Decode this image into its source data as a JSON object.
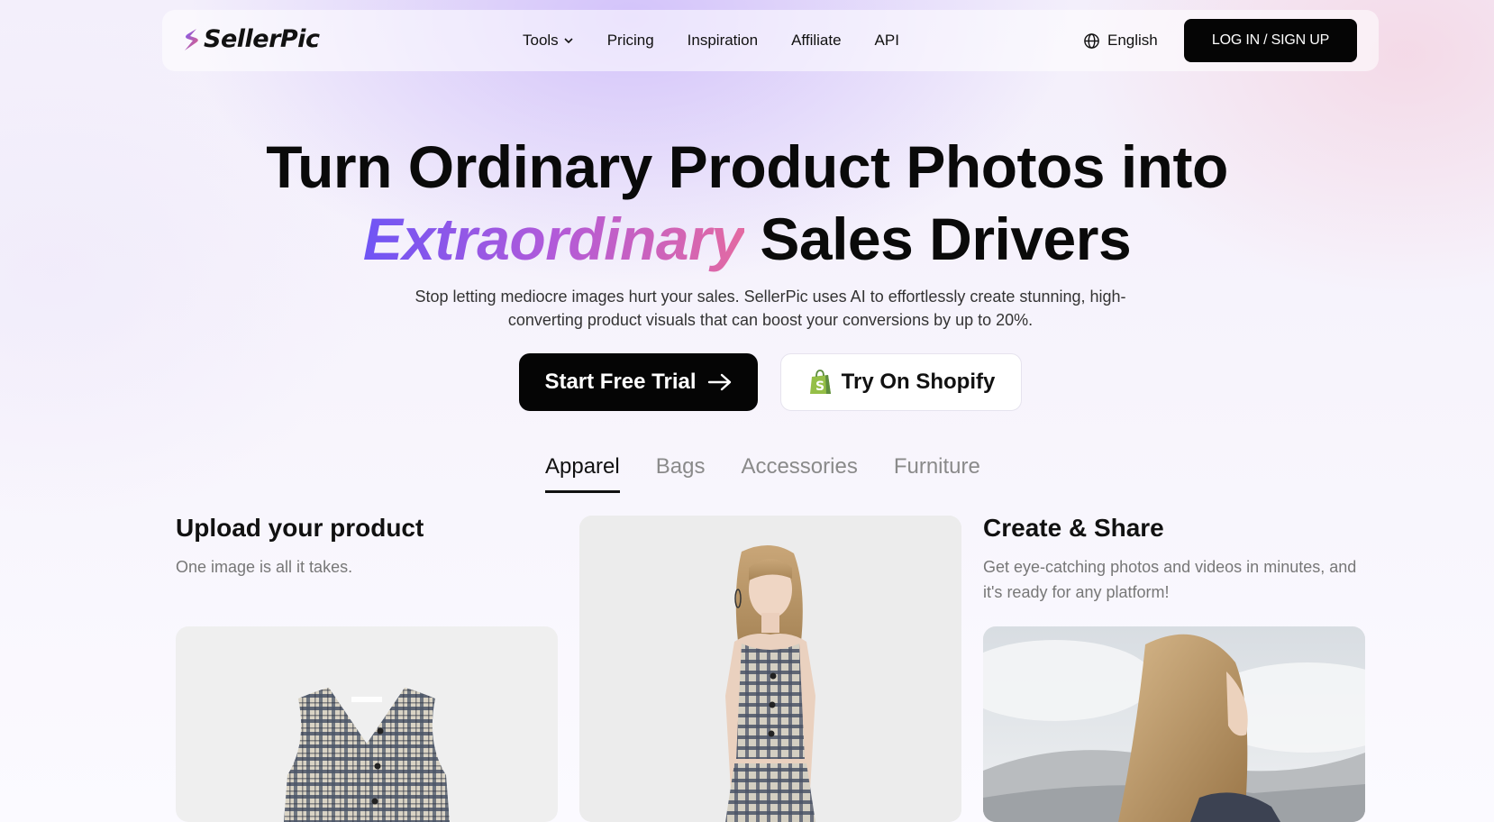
{
  "brand": {
    "name": "SellerPic"
  },
  "nav": {
    "items": [
      {
        "label": "Tools",
        "has_dropdown": true
      },
      {
        "label": "Pricing"
      },
      {
        "label": "Inspiration"
      },
      {
        "label": "Affiliate"
      },
      {
        "label": "API"
      }
    ],
    "language": "English",
    "login_label": "LOG IN / SIGN UP"
  },
  "hero": {
    "title_line1": "Turn Ordinary Product Photos into",
    "title_accent": "Extraordinary",
    "title_line2_rest": "Sales Drivers",
    "subtitle": "Stop letting mediocre images hurt your sales. SellerPic uses AI to effortlessly create stunning, high-converting product visuals that can boost your conversions by up to 20%.",
    "primary_cta": "Start Free Trial",
    "secondary_cta": "Try On Shopify"
  },
  "tabs": [
    {
      "label": "Apparel",
      "active": true
    },
    {
      "label": "Bags"
    },
    {
      "label": "Accessories"
    },
    {
      "label": "Furniture"
    }
  ],
  "steps": {
    "upload": {
      "title": "Upload your product",
      "desc": "One image is all it takes."
    },
    "create": {
      "title": "Create & Share",
      "desc": "Get eye-catching photos and videos in minutes, and it's ready for any platform!"
    }
  },
  "colors": {
    "accent_gradient_start": "#6f55f5",
    "accent_gradient_end": "#e36aa2",
    "primary_button": "#050505",
    "shopify_green": "#95bf47"
  }
}
